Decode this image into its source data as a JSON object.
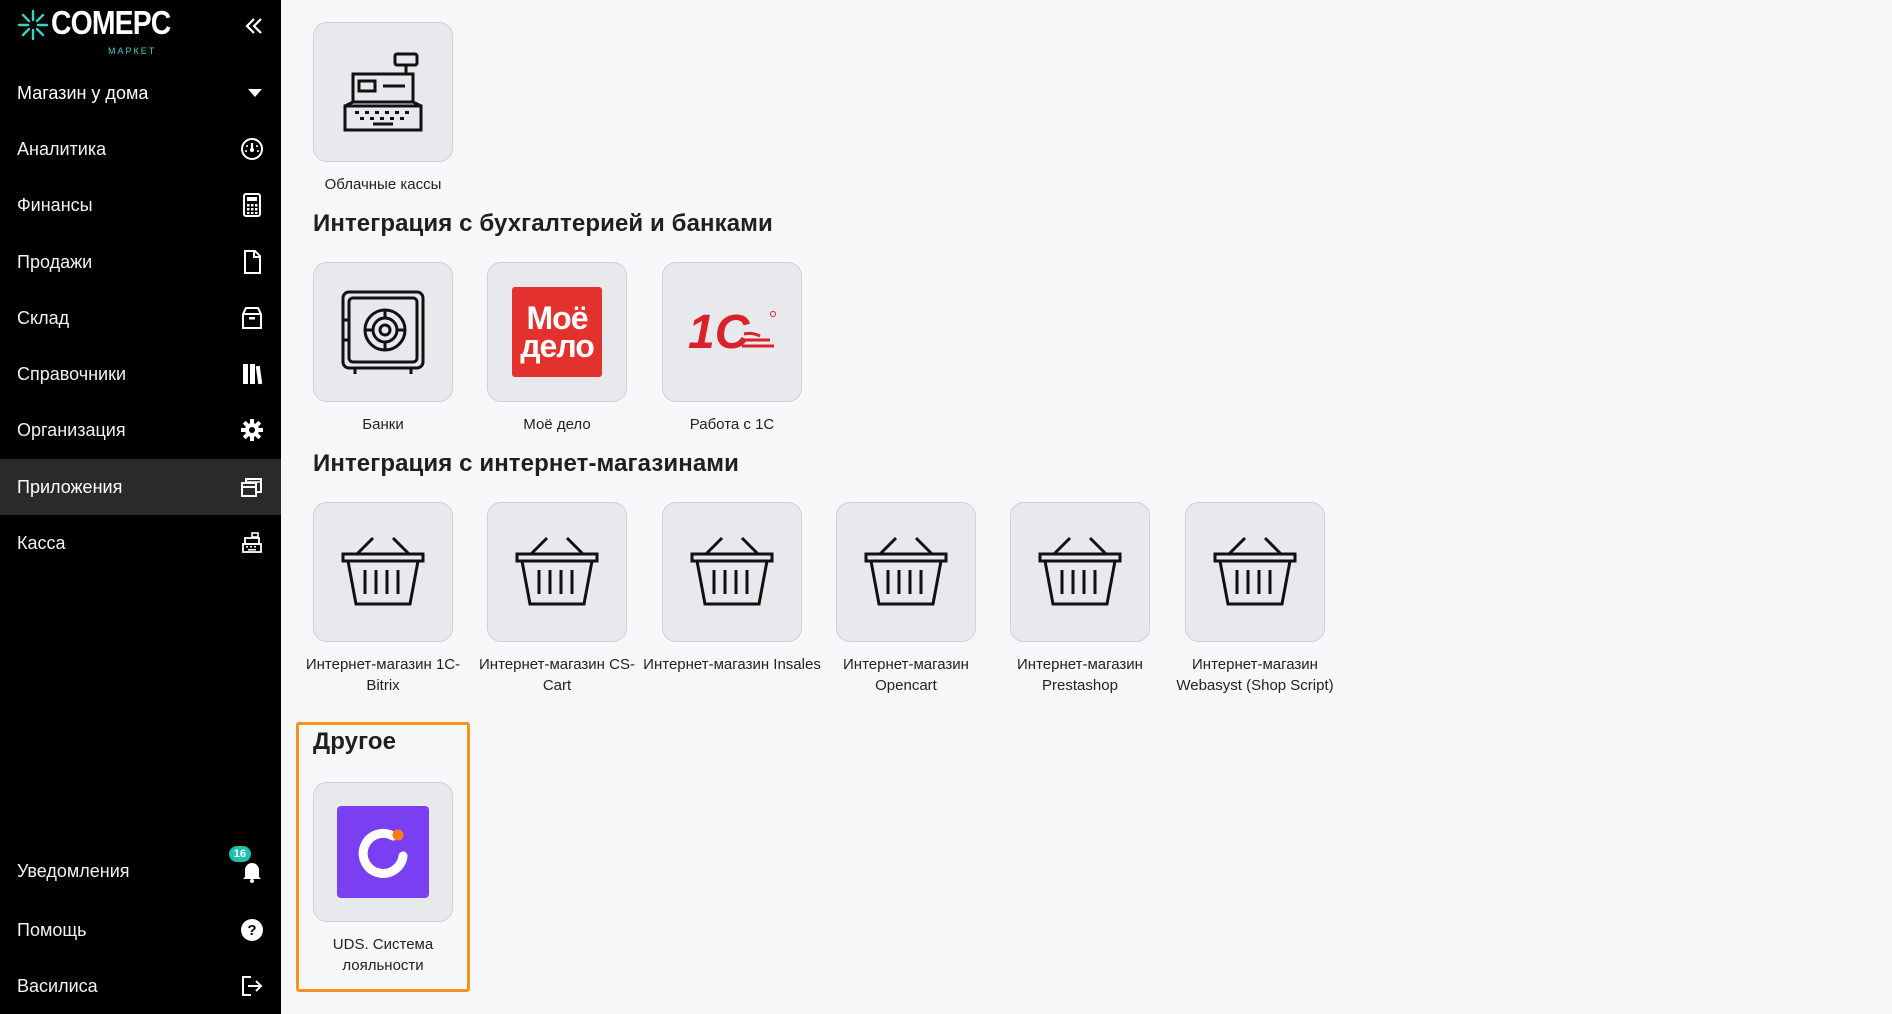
{
  "brand": {
    "logo_main": "COMEPC",
    "logo_sub": "МАРКЕТ",
    "accent": "#3dcfc3"
  },
  "sidebar": {
    "store_selector": {
      "label": "Магазин у дома",
      "icon": "caret-down-icon"
    },
    "items": [
      {
        "label": "Аналитика",
        "icon": "gauge-icon"
      },
      {
        "label": "Финансы",
        "icon": "calculator-icon"
      },
      {
        "label": "Продажи",
        "icon": "document-icon"
      },
      {
        "label": "Склад",
        "icon": "box-icon"
      },
      {
        "label": "Справочники",
        "icon": "books-icon"
      },
      {
        "label": "Организация",
        "icon": "gear-icon"
      },
      {
        "label": "Приложения",
        "icon": "windows-icon",
        "active": true
      },
      {
        "label": "Касса",
        "icon": "cash-register-icon"
      }
    ],
    "bottom_items": [
      {
        "label": "Уведомления",
        "icon": "bell-icon",
        "badge": "16"
      },
      {
        "label": "Помощь",
        "icon": "help-icon"
      },
      {
        "label": "Василиса",
        "icon": "logout-icon"
      }
    ]
  },
  "sections": {
    "cloud": {
      "apps": [
        {
          "label": "Облачные кассы"
        }
      ]
    },
    "accounting": {
      "title": "Интеграция с бухгалтерией и банками",
      "apps": [
        {
          "label": "Банки"
        },
        {
          "label": "Моё дело",
          "logo_text_1": "Моё",
          "logo_text_2": "дело"
        },
        {
          "label": "Работа с 1С",
          "logo_text": "1С"
        }
      ]
    },
    "shops": {
      "title": "Интеграция с интернет-магазинами",
      "apps": [
        {
          "label": "Интернет-магазин 1C-Bitrix"
        },
        {
          "label": "Интернет-магазин CS-Cart"
        },
        {
          "label": "Интернет-магазин Insales"
        },
        {
          "label": "Интернет-магазин Opencart"
        },
        {
          "label": "Интернет-магазин Prestashop"
        },
        {
          "label": "Интернет-магазин Webasyst (Shop Script)"
        }
      ]
    },
    "other": {
      "title": "Другое",
      "apps": [
        {
          "label": "UDS. Система лояльности"
        }
      ]
    }
  },
  "colors": {
    "sidebar_bg": "#000000",
    "active_item_bg": "#2a2a2a",
    "page_bg": "#f6f7f9",
    "tile_bg": "#e8e9ed",
    "highlight": "#f7941d",
    "moe_delo_red": "#e3312d",
    "one_c_red": "#d8232a",
    "uds_purple": "#7b3ff2",
    "uds_dot": "#ff7a1a"
  }
}
